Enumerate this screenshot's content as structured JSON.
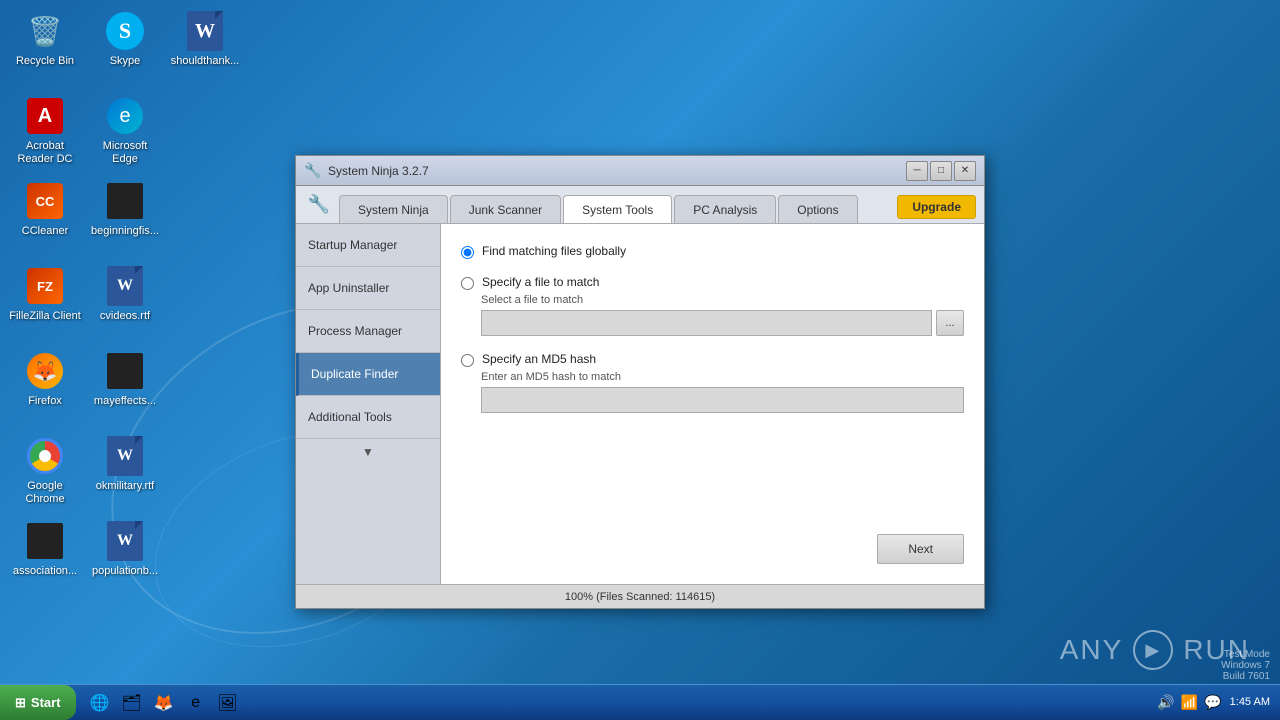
{
  "desktop": {
    "icons": [
      {
        "id": "recycle-bin",
        "label": "Recycle Bin",
        "icon": "🗑"
      },
      {
        "id": "skype",
        "label": "Skype",
        "icon": "S"
      },
      {
        "id": "shouldthank",
        "label": "shouldthank...",
        "icon": "W"
      },
      {
        "id": "acrobat",
        "label": "Acrobat Reader DC",
        "icon": "A"
      },
      {
        "id": "microsoft-edge",
        "label": "Microsoft Edge",
        "icon": "e"
      },
      {
        "id": "ccleaner",
        "label": "CCleaner",
        "icon": "CC"
      },
      {
        "id": "beginningfis",
        "label": "beginningfis...",
        "icon": "▬"
      },
      {
        "id": "filezilla",
        "label": "FilleZilla Client",
        "icon": "FZ"
      },
      {
        "id": "cvideos-rtf",
        "label": "cvideos.rtf",
        "icon": "W"
      },
      {
        "id": "firefox",
        "label": "Firefox",
        "icon": "🦊"
      },
      {
        "id": "mayeffects",
        "label": "mayeffects...",
        "icon": "▬"
      },
      {
        "id": "google-chrome",
        "label": "Google Chrome",
        "icon": ""
      },
      {
        "id": "okmilitary-rtf",
        "label": "okmilitary.rtf",
        "icon": "W"
      },
      {
        "id": "association",
        "label": "association...",
        "icon": "▬"
      },
      {
        "id": "populationb",
        "label": "populationb...",
        "icon": "W"
      }
    ]
  },
  "taskbar": {
    "start_label": "Start",
    "time": "1:45 AM",
    "date": "",
    "icons": [
      "🌐",
      "🗂",
      "🦊",
      "e",
      "🖼"
    ]
  },
  "window": {
    "title": "System Ninja 3.2.7",
    "tabs": [
      {
        "id": "system-ninja",
        "label": "System Ninja",
        "active": false
      },
      {
        "id": "junk-scanner",
        "label": "Junk Scanner",
        "active": false
      },
      {
        "id": "system-tools",
        "label": "System Tools",
        "active": true
      },
      {
        "id": "pc-analysis",
        "label": "PC Analysis",
        "active": false
      },
      {
        "id": "options",
        "label": "Options",
        "active": false
      },
      {
        "id": "upgrade",
        "label": "Upgrade",
        "active": false
      }
    ],
    "sidebar": {
      "items": [
        {
          "id": "startup-manager",
          "label": "Startup Manager",
          "active": false
        },
        {
          "id": "app-uninstaller",
          "label": "App Uninstaller",
          "active": false
        },
        {
          "id": "process-manager",
          "label": "Process Manager",
          "active": false
        },
        {
          "id": "duplicate-finder",
          "label": "Duplicate Finder",
          "active": true
        },
        {
          "id": "additional-tools",
          "label": "Additional Tools",
          "active": false
        }
      ]
    },
    "duplicate_finder": {
      "radio_options": [
        {
          "id": "find-globally",
          "label": "Find matching files globally",
          "checked": true
        },
        {
          "id": "specify-file",
          "label": "Specify a file to match",
          "checked": false
        },
        {
          "id": "specify-md5",
          "label": "Specify an MD5 hash",
          "checked": false
        }
      ],
      "file_section": {
        "sublabel": "Select a file to match",
        "input_value": "",
        "browse_label": "..."
      },
      "md5_section": {
        "sublabel": "Enter an MD5 hash to match",
        "input_value": ""
      },
      "next_button": "Next"
    },
    "status_bar": "100% (Files Scanned: 114615)"
  },
  "anyrun": {
    "label": "ANY",
    "suffix": "RUN",
    "mode": "Test Mode",
    "os": "Windows 7",
    "build": "Build 7601"
  }
}
